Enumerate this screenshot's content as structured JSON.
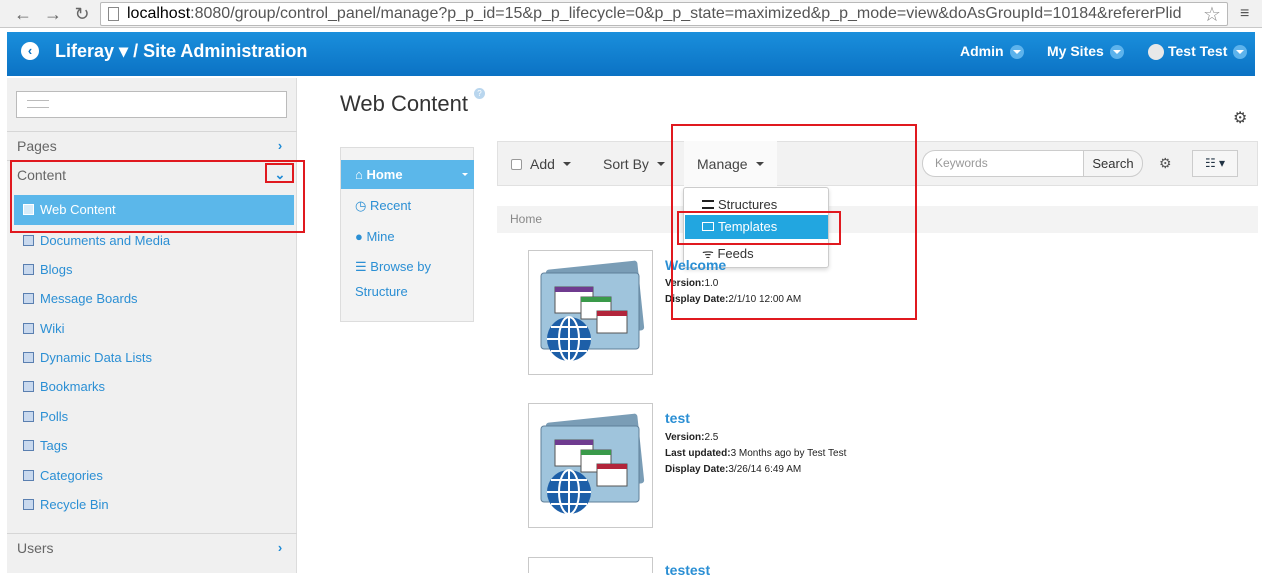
{
  "browser": {
    "url_host": "localhost",
    "url_rest": ":8080/group/control_panel/manage?p_p_id=15&p_p_lifecycle=0&p_p_state=maximized&p_p_mode=view&doAsGroupId=10184&refererPlid"
  },
  "dockbar": {
    "title": "Liferay ▾ / Site Administration",
    "admin": "Admin",
    "my_sites": "My Sites",
    "user": "Test Test"
  },
  "sidebar": {
    "pages": "Pages",
    "content": "Content",
    "active_item": "Web Content",
    "items": [
      "Documents and Media",
      "Blogs",
      "Message Boards",
      "Wiki",
      "Dynamic Data Lists",
      "Bookmarks",
      "Polls",
      "Tags",
      "Categories",
      "Recycle Bin"
    ],
    "users": "Users"
  },
  "main": {
    "title": "Web Content",
    "folder_nav": {
      "home": "Home",
      "recent": "Recent",
      "mine": "Mine",
      "browse_line1": "Browse by",
      "browse_line2": "Structure"
    },
    "toolbar": {
      "add": "Add",
      "sort_by": "Sort By",
      "manage": "Manage",
      "keywords_placeholder": "Keywords",
      "search": "Search"
    },
    "manage_menu": {
      "structures": "Structures",
      "templates": "Templates",
      "feeds": "Feeds"
    },
    "breadcrumb": "Home",
    "articles": [
      {
        "title": "Welcome",
        "version_label": "Version:",
        "version": "1.0",
        "date_label": "Display Date:",
        "date": "2/1/10 12:00 AM"
      },
      {
        "title": "test",
        "version_label": "Version:",
        "version": "2.5",
        "updated_label": "Last updated:",
        "updated": "3 Months ago by Test Test",
        "date_label": "Display Date:",
        "date": "3/26/14 6:49 AM"
      },
      {
        "title": "testest"
      }
    ]
  },
  "colors": {
    "dockbar": "#0b72c4",
    "active": "#5bb7ea",
    "link": "#2b8fd4",
    "highlight_box": "#e0191f"
  }
}
